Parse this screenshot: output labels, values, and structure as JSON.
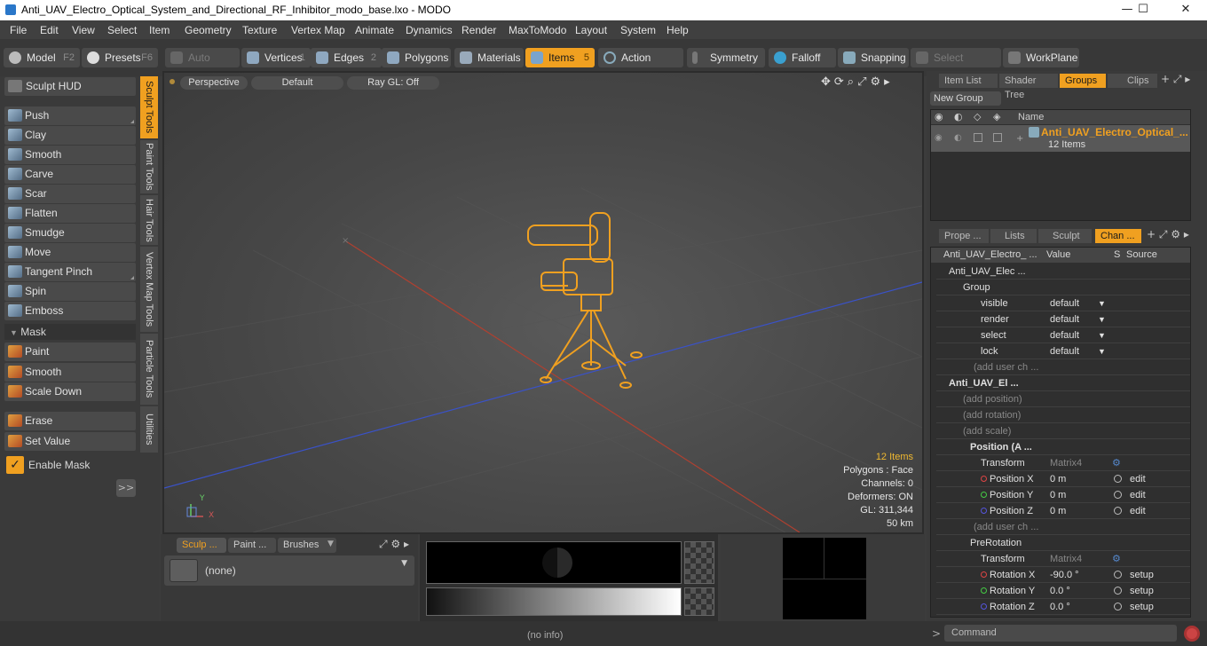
{
  "window": {
    "title": "Anti_UAV_Electro_Optical_System_and_Directional_RF_Inhibitor_modo_base.lxo - MODO",
    "min": "—",
    "max": "☐",
    "close": "✕"
  },
  "menu": [
    "File",
    "Edit",
    "View",
    "Select",
    "Item",
    "Geometry",
    "Texture",
    "Vertex Map",
    "Animate",
    "Dynamics",
    "Render",
    "MaxToModo",
    "Layout",
    "System",
    "Help"
  ],
  "toolbar": {
    "model": "Model",
    "model_key": "F2",
    "presets": "Presets",
    "presets_key": "F6",
    "auto_select": "Auto Select",
    "vertices": "Vertices",
    "vertices_key": "1",
    "edges": "Edges",
    "edges_key": "2",
    "polygons": "Polygons",
    "materials": "Materials",
    "items": "Items",
    "items_key": "5",
    "action_center": "Action Center",
    "symmetry": "Symmetry",
    "falloff": "Falloff",
    "snapping": "Snapping",
    "select_through": "Select Through",
    "workplane": "WorkPlane"
  },
  "left": {
    "sculpt_hud": "Sculpt HUD",
    "tools": [
      "Push",
      "Clay",
      "Smooth",
      "Carve",
      "Scar",
      "Flatten",
      "Smudge",
      "Move",
      "Tangent Pinch",
      "Spin",
      "Emboss"
    ],
    "mask_header": "Mask",
    "mask_tools": [
      "Paint",
      "Smooth",
      "Scale Down"
    ],
    "erase": "Erase",
    "set_value": "Set Value",
    "enable_mask": "Enable Mask",
    "expand": ">>",
    "vtabs": [
      "Sculpt Tools",
      "Paint Tools",
      "Hair Tools",
      "Vertex Map Tools",
      "Particle Tools",
      "Utilities"
    ]
  },
  "viewport": {
    "perspective": "Perspective",
    "default": "Default",
    "raygl": "Ray GL: Off",
    "stats": {
      "items": "12 Items",
      "polygons": "Polygons : Face",
      "channels": "Channels: 0",
      "deformers": "Deformers: ON",
      "gl": "GL: 311,344",
      "distance": "50 km"
    },
    "axis_y": "Y",
    "axis_x": "X"
  },
  "bottom": {
    "tabs": [
      "Sculp ...",
      "Paint ...",
      "Brushes"
    ],
    "brush": "(none)"
  },
  "right_top": {
    "tabs": [
      "Item List",
      "Shader Tree",
      "Groups",
      "Clips"
    ],
    "new_group": "New Group",
    "col_name": "Name",
    "group_name": "Anti_UAV_Electro_Optical_...",
    "group_count": "12 Items"
  },
  "right_bottom": {
    "tabs": [
      "Prope ...",
      "Lists",
      "Sculpt",
      "Chan ..."
    ],
    "header": {
      "name": "Anti_UAV_Electro_ ...",
      "value": "Value",
      "s": "S",
      "source": "Source"
    },
    "rows": [
      {
        "label": "Anti_UAV_Elec ...",
        "value": "",
        "source": ""
      },
      {
        "label": "Group",
        "value": "",
        "source": ""
      },
      {
        "label": "visible",
        "value": "default",
        "source": ""
      },
      {
        "label": "render",
        "value": "default",
        "source": ""
      },
      {
        "label": "select",
        "value": "default",
        "source": ""
      },
      {
        "label": "lock",
        "value": "default",
        "source": ""
      },
      {
        "label": "(add user ch ...",
        "value": "",
        "source": ""
      },
      {
        "label": "Anti_UAV_El ...",
        "value": "",
        "source": ""
      },
      {
        "label": "(add position)",
        "value": "",
        "source": ""
      },
      {
        "label": "(add rotation)",
        "value": "",
        "source": ""
      },
      {
        "label": "(add scale)",
        "value": "",
        "source": ""
      },
      {
        "label": "Position (A ...",
        "value": "",
        "source": ""
      },
      {
        "label": "Transform",
        "value": "Matrix4",
        "source": ""
      },
      {
        "label": "Position X",
        "value": "0 m",
        "source": "edit"
      },
      {
        "label": "Position Y",
        "value": "0 m",
        "source": "edit"
      },
      {
        "label": "Position Z",
        "value": "0 m",
        "source": "edit"
      },
      {
        "label": "(add user ch ...",
        "value": "",
        "source": ""
      },
      {
        "label": "PreRotation",
        "value": "",
        "source": ""
      },
      {
        "label": "Transform",
        "value": "Matrix4",
        "source": ""
      },
      {
        "label": "Rotation X",
        "value": "-90.0 °",
        "source": "setup"
      },
      {
        "label": "Rotation Y",
        "value": "0.0 °",
        "source": "setup"
      },
      {
        "label": "Rotation Z",
        "value": "0.0 °",
        "source": "setup"
      }
    ]
  },
  "status": {
    "info": "(no info)",
    "command": "Command"
  },
  "colors": {
    "accent": "#f0a020",
    "bg": "#3c3c3c"
  }
}
